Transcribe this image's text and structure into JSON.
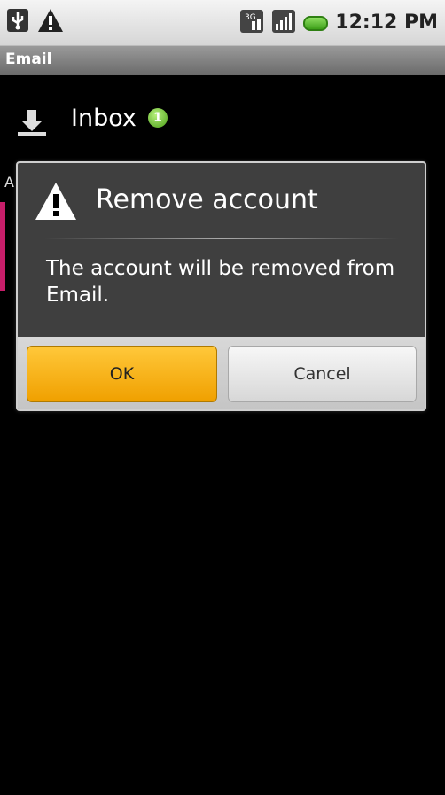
{
  "status_bar": {
    "time": "12:12 PM",
    "icons": [
      "usb-icon",
      "warning-icon",
      "3g-icon",
      "signal-icon",
      "battery-icon"
    ]
  },
  "title_bar": {
    "title": "Email"
  },
  "list": {
    "inbox_label": "Inbox",
    "inbox_unread_count": "1",
    "partial_letter": "A"
  },
  "dialog": {
    "title": "Remove account",
    "message": "The account will be removed from Email.",
    "ok_label": "OK",
    "cancel_label": "Cancel"
  },
  "colors": {
    "ok_button": "#f0a000",
    "dialog_bg": "#3f3f3f",
    "badge_green": "#4a9f16"
  }
}
